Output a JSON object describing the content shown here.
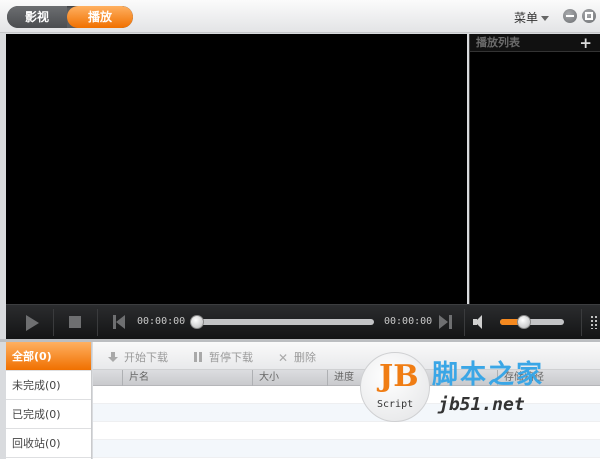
{
  "titlebar": {
    "tabs": [
      {
        "label": "影视"
      },
      {
        "label": "播放"
      }
    ],
    "menu_label": "菜单"
  },
  "playlist": {
    "title": "播放列表",
    "add_glyph": "+"
  },
  "controls": {
    "current_time": "00:00:00",
    "total_time": "00:00:00",
    "seek_progress": 0,
    "volume_level": 0.37
  },
  "downloads": {
    "sidebar": [
      {
        "label": "全部(0)"
      },
      {
        "label": "未完成(0)"
      },
      {
        "label": "已完成(0)"
      },
      {
        "label": "回收站(0)"
      }
    ],
    "toolbar": {
      "start_label": "开始下载",
      "pause_label": "暂停下载",
      "delete_label": "删除",
      "delete_glyph": "✕"
    },
    "columns": [
      "片名",
      "大小",
      "进度",
      "",
      "存储路径"
    ]
  },
  "watermark": {
    "badge": "JB",
    "badge_sub": "Script",
    "cn_text": "脚本之家",
    "url": "jb51.net"
  },
  "colors": {
    "accent": "#f07000",
    "accent_light": "#ffb061",
    "video_bg": "#000000"
  }
}
